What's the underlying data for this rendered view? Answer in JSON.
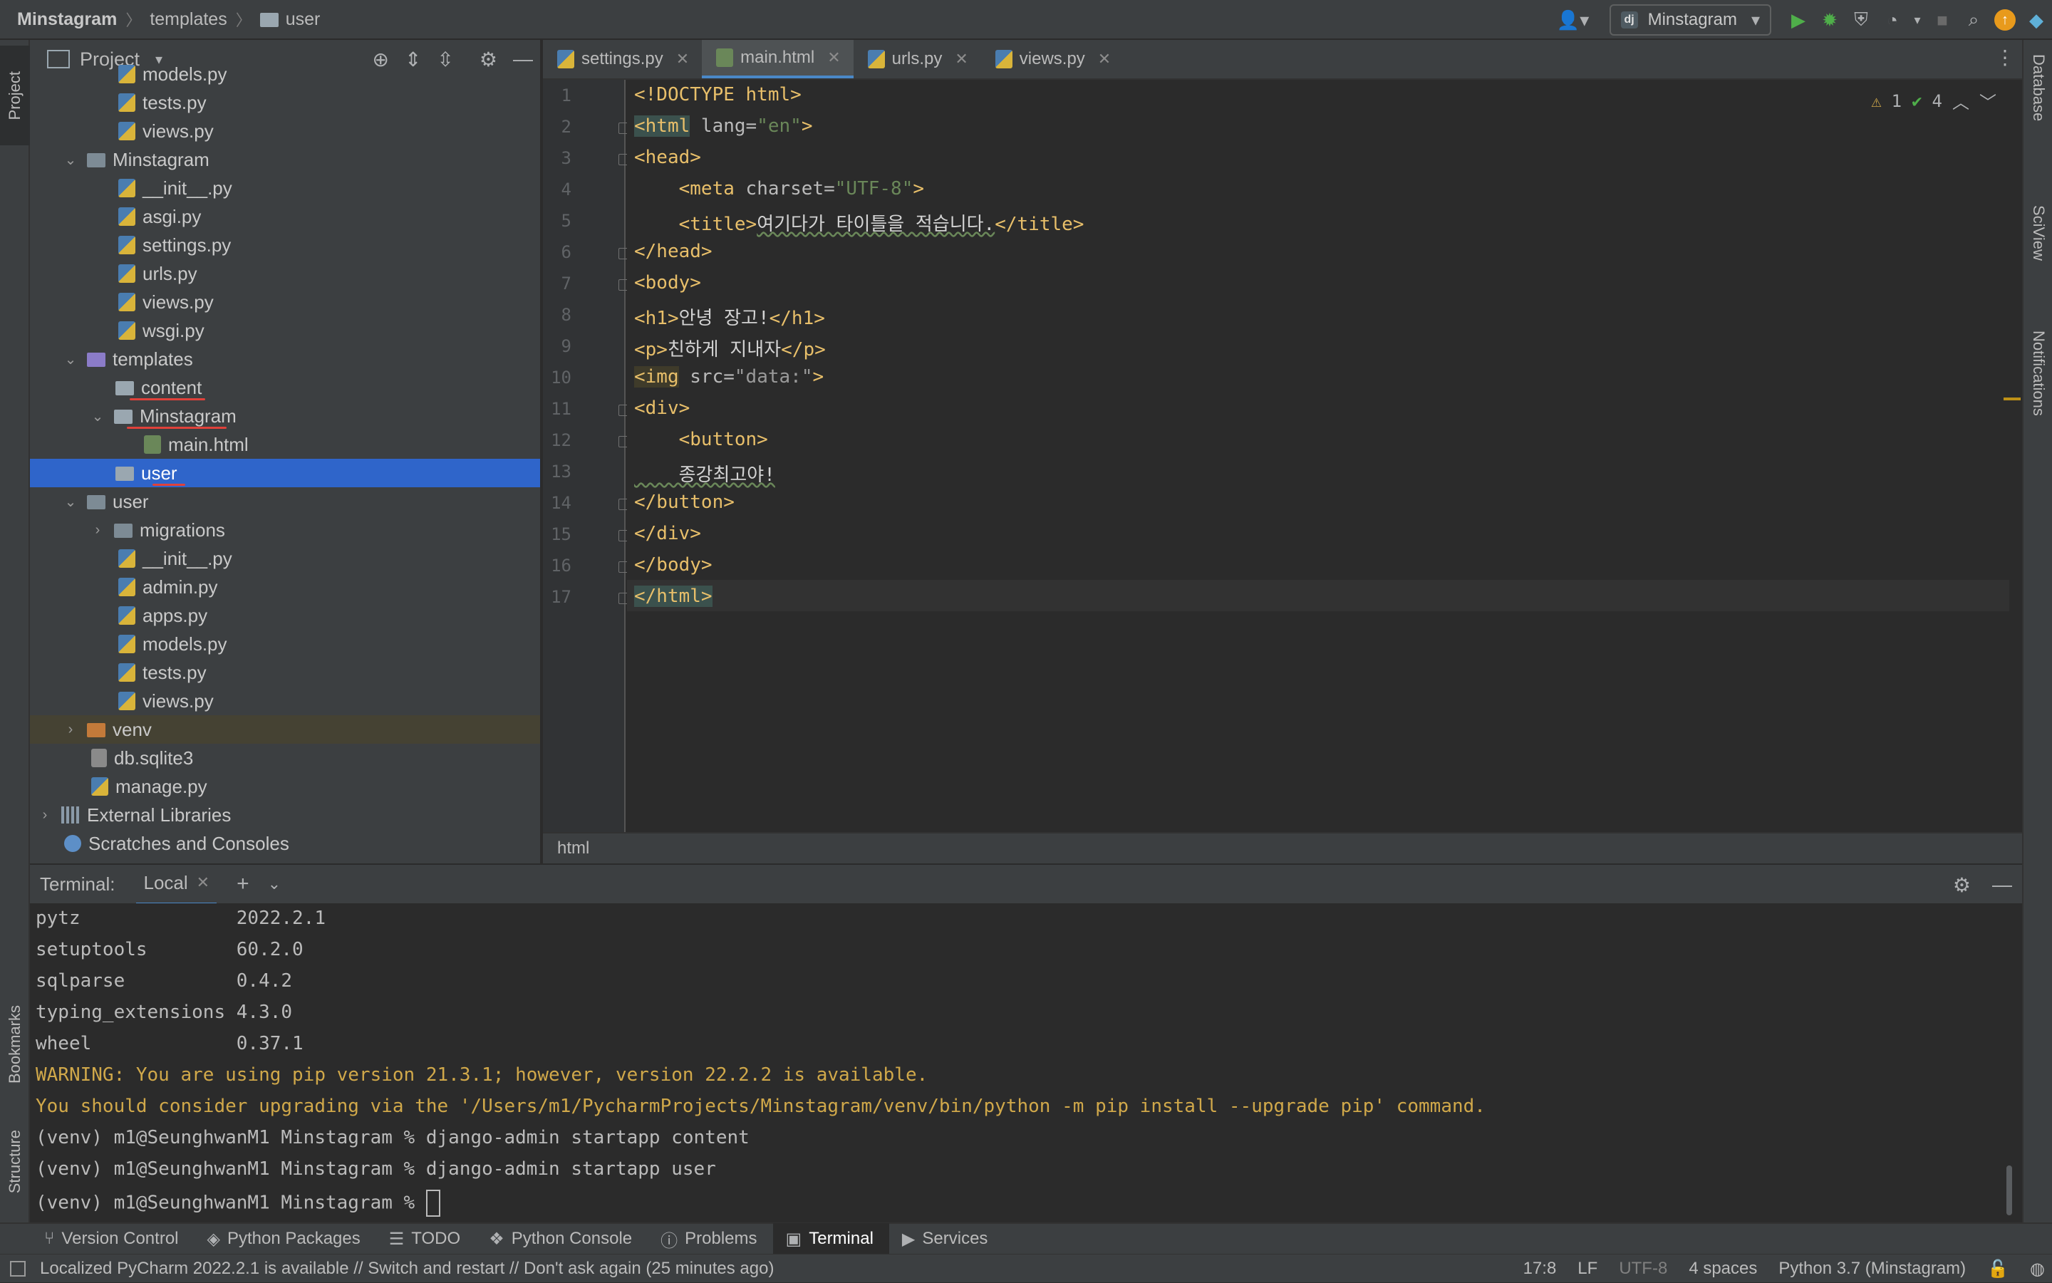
{
  "navbar": {
    "project": "Minstagram",
    "crumbs": [
      "templates",
      "user"
    ],
    "run_config": "Minstagram"
  },
  "left_stripe": {
    "project": "Project",
    "bookmarks": "Bookmarks",
    "structure": "Structure"
  },
  "right_stripe": {
    "database": "Database",
    "sciview": "SciView",
    "notifications": "Notifications"
  },
  "project_panel": {
    "title": "Project",
    "tree": [
      {
        "label": "models.py",
        "type": "py"
      },
      {
        "label": "tests.py",
        "type": "py"
      },
      {
        "label": "views.py",
        "type": "py"
      },
      {
        "label": "Minstagram",
        "type": "folder-dark"
      },
      {
        "label": "__init__.py",
        "type": "py"
      },
      {
        "label": "asgi.py",
        "type": "py"
      },
      {
        "label": "settings.py",
        "type": "py"
      },
      {
        "label": "urls.py",
        "type": "py"
      },
      {
        "label": "views.py",
        "type": "py"
      },
      {
        "label": "wsgi.py",
        "type": "py"
      },
      {
        "label": "templates",
        "type": "folder-purple"
      },
      {
        "label": "content",
        "type": "folder"
      },
      {
        "label": "Minstagram",
        "type": "folder"
      },
      {
        "label": "main.html",
        "type": "html"
      },
      {
        "label": "user",
        "type": "folder"
      },
      {
        "label": "user",
        "type": "folder-dark"
      },
      {
        "label": "migrations",
        "type": "folder-dark"
      },
      {
        "label": "__init__.py",
        "type": "py"
      },
      {
        "label": "admin.py",
        "type": "py"
      },
      {
        "label": "apps.py",
        "type": "py"
      },
      {
        "label": "models.py",
        "type": "py"
      },
      {
        "label": "tests.py",
        "type": "py"
      },
      {
        "label": "views.py",
        "type": "py"
      },
      {
        "label": "venv",
        "type": "folder-orange"
      },
      {
        "label": "db.sqlite3",
        "type": "db"
      },
      {
        "label": "manage.py",
        "type": "py"
      },
      {
        "label": "External Libraries",
        "type": "lib"
      },
      {
        "label": "Scratches and Consoles",
        "type": "scratch"
      }
    ]
  },
  "editor": {
    "tabs": [
      {
        "label": "settings.py"
      },
      {
        "label": "main.html"
      },
      {
        "label": "urls.py"
      },
      {
        "label": "views.py"
      }
    ],
    "inspections": {
      "warnings": "1",
      "ok": "4"
    },
    "line_numbers": [
      "1",
      "2",
      "3",
      "4",
      "5",
      "6",
      "7",
      "8",
      "9",
      "10",
      "11",
      "12",
      "13",
      "14",
      "15",
      "16",
      "17"
    ],
    "code": {
      "l1": "<!DOCTYPE html>",
      "l2a": "<html",
      "l2b": " lang=",
      "l2c": "\"en\"",
      "l2d": ">",
      "l3": "<head>",
      "l4a": "    <meta",
      "l4b": " charset=",
      "l4c": "\"UTF-8\"",
      "l4d": ">",
      "l5a": "    <title>",
      "l5b": "여기다가 타이틀을 적습니다.",
      "l5c": "</title>",
      "l6": "</head>",
      "l7": "<body>",
      "l8a": "<h1>",
      "l8b": "안녕 장고!",
      "l8c": "</h1>",
      "l9a": "<p>",
      "l9b": "친하게 지내자",
      "l9c": "</p>",
      "l10a": "<img",
      "l10b": " src=",
      "l10c": "\"data:\"",
      "l10d": ">",
      "l11": "<div>",
      "l12": "    <button>",
      "l13": "    종강최고야!",
      "l14": "</button>",
      "l15": "</div>",
      "l16": "</body>",
      "l17": "</html>"
    },
    "breadcrumb": "html"
  },
  "terminal": {
    "label": "Terminal:",
    "tab": "Local",
    "lines": [
      "pytz              2022.2.1",
      "setuptools        60.2.0",
      "sqlparse          0.4.2",
      "typing_extensions 4.3.0",
      "wheel             0.37.1",
      "WARNING: You are using pip version 21.3.1; however, version 22.2.2 is available.",
      "You should consider upgrading via the '/Users/m1/PycharmProjects/Minstagram/venv/bin/python -m pip install --upgrade pip' command.",
      "(venv) m1@SeunghwanM1 Minstagram % django-admin startapp content",
      "(venv) m1@SeunghwanM1 Minstagram % django-admin startapp user",
      "(venv) m1@SeunghwanM1 Minstagram % "
    ]
  },
  "toolwindows": [
    {
      "label": "Version Control",
      "icon": "branch-icon"
    },
    {
      "label": "Python Packages",
      "icon": "layers-icon"
    },
    {
      "label": "TODO",
      "icon": "list-icon"
    },
    {
      "label": "Python Console",
      "icon": "python-icon"
    },
    {
      "label": "Problems",
      "icon": "info-icon"
    },
    {
      "label": "Terminal",
      "icon": "terminal-icon"
    },
    {
      "label": "Services",
      "icon": "play-circle-icon"
    }
  ],
  "status": {
    "message": "Localized PyCharm 2022.2.1 is available // Switch and restart // Don't ask again (25 minutes ago)",
    "position": "17:8",
    "line_sep": "LF",
    "encoding": "UTF-8",
    "indent": "4 spaces",
    "interpreter": "Python 3.7 (Minstagram)"
  },
  "colors": {
    "accent": "#4a88c7",
    "selection": "#2f65ca",
    "tag": "#e8bf6a",
    "string": "#6a8759",
    "warning": "#d0a84a"
  }
}
